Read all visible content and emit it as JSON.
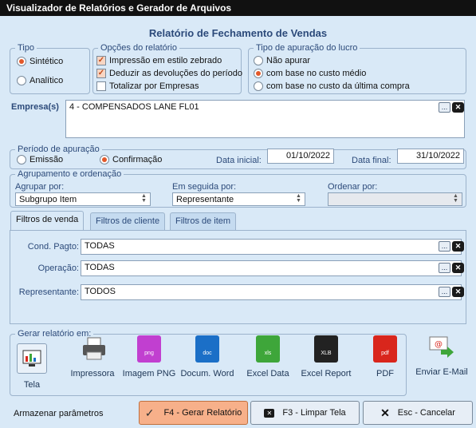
{
  "window": {
    "title": "Visualizador de Relatórios e Gerador de Arquivos"
  },
  "report_title": "Relatório de Fechamento de Vendas",
  "tipo": {
    "legend": "Tipo",
    "options": [
      "Sintético",
      "Analítico"
    ],
    "selected": "Sintético"
  },
  "opcoes": {
    "legend": "Opções do relatório",
    "items": [
      {
        "label": "Impressão em estilo zebrado",
        "checked": true
      },
      {
        "label": "Deduzir as devoluções do período",
        "checked": true
      },
      {
        "label": "Totalizar por Empresas",
        "checked": false
      }
    ]
  },
  "apuracao_lucro": {
    "legend": "Tipo de apuração do lucro",
    "options": [
      "Não apurar",
      "com base no custo médio",
      "com base no custo da última compra"
    ],
    "selected": "com base no custo médio"
  },
  "empresas": {
    "label": "Empresa(s)",
    "value": "4 - COMPENSADOS LANE FL01"
  },
  "periodo": {
    "legend": "Período de apuração",
    "options": [
      "Emissão",
      "Confirmação"
    ],
    "selected": "Confirmação",
    "data_inicial_label": "Data inicial:",
    "data_inicial": "01/10/2022",
    "data_final_label": "Data final:",
    "data_final": "31/10/2022"
  },
  "agrupamento": {
    "legend": "Agrupamento e ordenação",
    "agrupar_label": "Agrupar por:",
    "agrupar_value": "Subgrupo Item",
    "seguida_label": "Em seguida por:",
    "seguida_value": "Representante",
    "ordenar_label": "Ordenar por:",
    "ordenar_value": ""
  },
  "tabs": [
    "Filtros de venda",
    "Filtros de cliente",
    "Filtros de item"
  ],
  "filtros": [
    {
      "label": "Cond. Pagto:",
      "value": "TODAS"
    },
    {
      "label": "Operação:",
      "value": "TODAS"
    },
    {
      "label": "Representante:",
      "value": "TODOS"
    }
  ],
  "gerar": {
    "legend": "Gerar relatório em:",
    "outputs": [
      {
        "label": "Tela",
        "icon": "screen-chart-icon"
      },
      {
        "label": "Impressora",
        "icon": "printer-icon"
      },
      {
        "label": "Imagem PNG",
        "icon": "png-file-icon",
        "tag": "png",
        "color": "#c13fd0"
      },
      {
        "label": "Docum. Word",
        "icon": "word-file-icon",
        "tag": "doc",
        "color": "#1b6fc7"
      },
      {
        "label": "Excel Data",
        "icon": "excel-file-icon",
        "tag": "xls",
        "color": "#3ea63a"
      },
      {
        "label": "Excel Report",
        "icon": "xlb-file-icon",
        "tag": "XLB",
        "color": "#222222"
      },
      {
        "label": "PDF",
        "icon": "pdf-file-icon",
        "tag": "pdf",
        "color": "#d9261c"
      }
    ]
  },
  "email": {
    "label": "Enviar E-Mail",
    "icon": "email-send-icon"
  },
  "footer": {
    "armazenar": "Armazenar parâmetros",
    "gerar_btn": "F4 - Gerar Relatório",
    "limpar_btn": "F3 - Limpar Tela",
    "cancelar_btn": "Esc - Cancelar"
  },
  "icons": {
    "ellipsis": "...",
    "clear": "✕"
  },
  "colors": {
    "accent_orange": "#f7b08a",
    "label_blue": "#2c4a7a"
  }
}
